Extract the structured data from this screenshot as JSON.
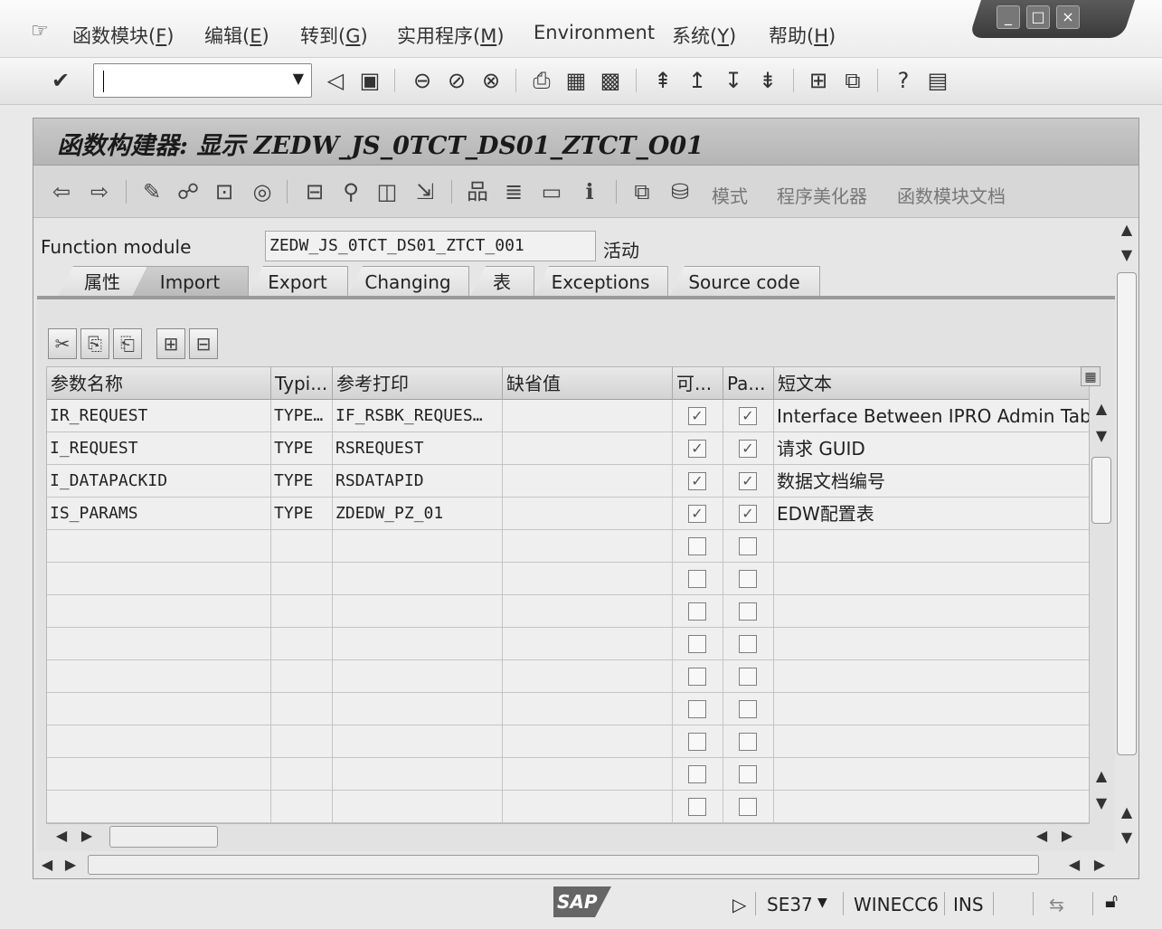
{
  "menubar": {
    "items": [
      {
        "text": "函数模块(",
        "key": "F",
        "end": ")"
      },
      {
        "text": "编辑(",
        "key": "E",
        "end": ")"
      },
      {
        "text": "转到(",
        "key": "G",
        "end": ")"
      },
      {
        "text": "实用程序(",
        "key": "M",
        "end": ")"
      },
      {
        "text": "Environment",
        "key": "",
        "end": ""
      },
      {
        "text": "系统(",
        "key": "Y",
        "end": ")"
      },
      {
        "text": "帮助(",
        "key": "H",
        "end": ")"
      }
    ]
  },
  "window": {
    "minimize": "_",
    "maximize": "□",
    "close": "×"
  },
  "toolbar": {
    "command_value": "",
    "dropdown": "▼"
  },
  "screen": {
    "title": "函数构建器: 显示 ZEDW_JS_0TCT_DS01_ZTCT_O01"
  },
  "app_toolbar": {
    "pattern": "模式",
    "pretty_printer": "程序美化器",
    "fm_doc": "函数模块文档"
  },
  "header": {
    "fm_label": "Function module",
    "fm_value": "ZEDW_JS_0TCT_DS01_ZTCT_001",
    "fm_status": "活动"
  },
  "tabs": [
    "属性",
    "Import",
    "Export",
    "Changing",
    "表",
    "Exceptions",
    "Source code"
  ],
  "active_tab": "Import",
  "table": {
    "columns": [
      "参数名称",
      "Typi...",
      "参考打印",
      "缺省值",
      "可...",
      "Pa...",
      "短文本"
    ],
    "rows": [
      {
        "name": "IR_REQUEST",
        "typing": "TYPE…",
        "ref": "IF_RSBK_REQUES…",
        "default": "",
        "optional": true,
        "pass_value": true,
        "text": "Interface Between IPRO Admin Tab"
      },
      {
        "name": "I_REQUEST",
        "typing": "TYPE",
        "ref": "RSREQUEST",
        "default": "",
        "optional": true,
        "pass_value": true,
        "text": "请求 GUID"
      },
      {
        "name": "I_DATAPACKID",
        "typing": "TYPE",
        "ref": "RSDATAPID",
        "default": "",
        "optional": true,
        "pass_value": true,
        "text": "数据文档编号"
      },
      {
        "name": "IS_PARAMS",
        "typing": "TYPE",
        "ref": "ZDEDW_PZ_01",
        "default": "",
        "optional": true,
        "pass_value": true,
        "text": "EDW配置表"
      }
    ],
    "empty_rows": 9
  },
  "status": {
    "logo": "SAP",
    "transaction": "SE37",
    "server": "WINECC6",
    "mode": "INS"
  }
}
